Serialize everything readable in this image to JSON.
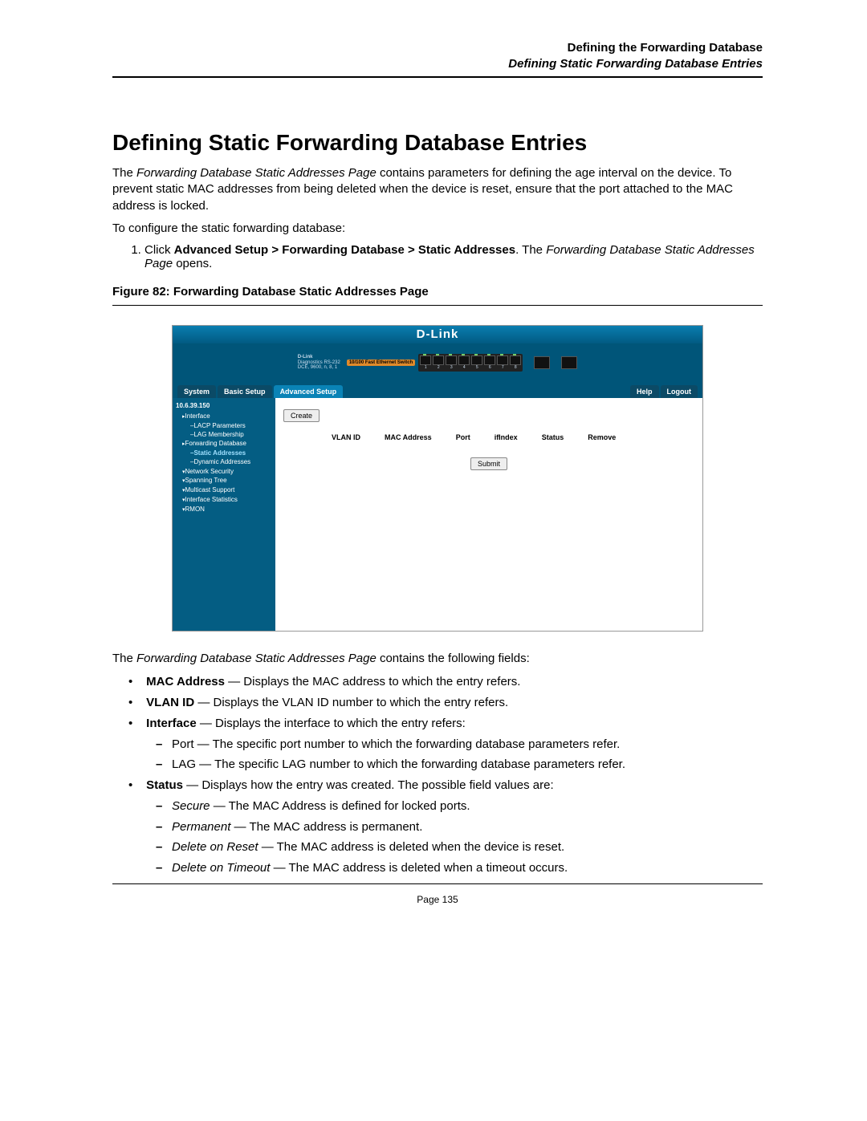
{
  "header": {
    "line1": "Defining the Forwarding Database",
    "line2": "Defining Static Forwarding Database Entries"
  },
  "title": "Defining Static Forwarding Database Entries",
  "intro": {
    "p1_pre": "The ",
    "p1_em": "Forwarding Database Static Addresses Page",
    "p1_post": " contains parameters for defining the age interval on the device. To prevent static MAC addresses from being deleted when the device is reset, ensure that the port attached to the MAC address is locked.",
    "p2": "To configure the static forwarding database:"
  },
  "step": {
    "pre": "Click ",
    "bold": "Advanced Setup > Forwarding Database > Static Addresses",
    "mid": ". The ",
    "em": "Forwarding Database Static Addresses Page",
    "post": " opens."
  },
  "figure_caption": "Figure 82:  Forwarding Database Static Addresses Page",
  "shot": {
    "brand": "D-Link",
    "device_brand": "D-Link",
    "badge": "10/100 Fast Ethernet Switch",
    "diag": "Diagnostics RS-232",
    "console": "DCE, 9600, n, 8, 1",
    "tabs": {
      "system": "System",
      "basic": "Basic Setup",
      "advanced": "Advanced Setup",
      "help": "Help",
      "logout": "Logout"
    },
    "tree": {
      "ip": "10.6.39.150",
      "interface": "Interface",
      "lacp": "LACP Parameters",
      "lag": "LAG Membership",
      "fdb": "Forwarding Database",
      "static": "Static Addresses",
      "dynamic": "Dynamic Addresses",
      "netsec": "Network Security",
      "stp": "Spanning Tree",
      "mcast": "Multicast Support",
      "ifstat": "Interface Statistics",
      "rmon": "RMON"
    },
    "main": {
      "create": "Create",
      "cols": {
        "vlan": "VLAN ID",
        "mac": "MAC Address",
        "port": "Port",
        "ifindex": "ifIndex",
        "status": "Status",
        "remove": "Remove"
      },
      "submit": "Submit"
    },
    "portnums": [
      "1",
      "2",
      "3",
      "4",
      "5",
      "6",
      "7",
      "8"
    ]
  },
  "after_fig": {
    "pre": "The ",
    "em": "Forwarding Database Static Addresses Page",
    "post": " contains the following fields:"
  },
  "fields": {
    "mac": {
      "label": "MAC Address",
      "desc": " — Displays the MAC address to which the entry refers."
    },
    "vlan": {
      "label": "VLAN ID",
      "desc": " — Displays the VLAN ID number to which the entry refers."
    },
    "iface": {
      "label": "Interface",
      "desc": " — Displays the interface to which the entry refers:"
    },
    "iface_sub": {
      "port": "Port — The specific port number to which the forwarding database parameters refer.",
      "lag": "LAG — The specific LAG number to which the forwarding database parameters refer."
    },
    "status": {
      "label": "Status",
      "desc": " — Displays how the entry was created. The possible field values are:"
    },
    "status_sub": {
      "secure": {
        "em": "Secure",
        "rest": " — The MAC Address is defined for locked ports."
      },
      "permanent": {
        "em": "Permanent",
        "rest": " — The MAC address is permanent."
      },
      "reset": {
        "em": "Delete on Reset",
        "rest": " — The MAC address is deleted when the device is reset."
      },
      "timeout": {
        "em": "Delete on Timeout",
        "rest": " — The MAC address is deleted when a timeout occurs."
      }
    }
  },
  "page_footer": "Page 135"
}
